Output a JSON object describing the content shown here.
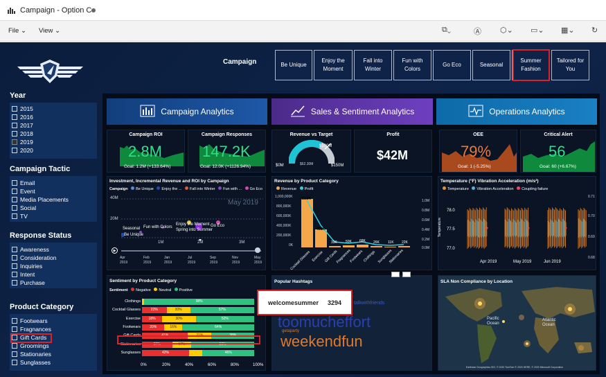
{
  "window": {
    "title": "Campaign - Option C"
  },
  "menu": {
    "file": "File",
    "view": "View"
  },
  "slicers": {
    "year": {
      "title": "Year",
      "items": [
        "2015",
        "2016",
        "2017",
        "2018",
        "2019",
        "2020"
      ],
      "checked": "2019"
    },
    "tactic": {
      "title": "Campaign Tactic",
      "items": [
        "Email",
        "Event",
        "Media Placements",
        "Social",
        "TV"
      ]
    },
    "response": {
      "title": "Response Status",
      "items": [
        "Awareness",
        "Consideration",
        "Inquiries",
        "Intent",
        "Purchase"
      ]
    },
    "category": {
      "title": "Product Category",
      "items": [
        "Footwears",
        "Fragnances",
        "Gift Cards",
        "Groomings",
        "Stationaries",
        "Sunglasses"
      ],
      "selected": "Gift Cards"
    }
  },
  "campaign": {
    "label": "Campaign",
    "buttons": [
      "Be Unique",
      "Enjoy the Moment",
      "Fall into Winter",
      "Fun with Colors",
      "Go Eco",
      "Seasonal",
      "Summer Fashion",
      "Tailored for You"
    ],
    "selected": "Summer Fashion"
  },
  "headers": {
    "campaign": "Campaign Analytics",
    "sales": "Sales & Sentiment Analytics",
    "ops": "Operations Analytics"
  },
  "kpi": {
    "roi": {
      "title": "Campaign ROI",
      "value": "2.8M",
      "goal": "Goal: 1.2M (+133.64%)"
    },
    "responses": {
      "title": "Campaign Responses",
      "value": "147.2K",
      "goal": "Goal: 12.0K (+1126.94%)"
    },
    "revenue": {
      "title": "Revenue vs Target",
      "min": "$0M",
      "max": "$150M",
      "target": "$100M",
      "value": "$62.30M"
    },
    "profit": {
      "title": "Profit",
      "value": "$42M"
    },
    "oee": {
      "title": "OEE",
      "value": "79%",
      "goal": "Goal: 1 (-5.25%)"
    },
    "alert": {
      "title": "Critical Alert",
      "value": "56",
      "goal": "Goal: 60 (+6.67%)"
    }
  },
  "investment": {
    "title": "Investment, Incremental Revenue and ROI by Campaign",
    "legend_label": "Campaign",
    "legend": [
      "Be Unique",
      "Enjoy the ...",
      "Fall into Winter",
      "Fun with ...",
      "Go Eco"
    ],
    "watermark": "May 2019",
    "yticks": [
      "40M",
      "20M"
    ],
    "xticks": [
      "1M",
      "2M",
      "3M"
    ],
    "points": [
      "Seasonal",
      "Be Unique",
      "Fun with Colors",
      "Enjoy the Moment",
      "Spring into Summer",
      "Go Eco"
    ],
    "timeline": [
      "Apr 2019",
      "Feb 2019",
      "Jan 2019",
      "Jul 2019",
      "Sep 2019",
      "Nov 2019",
      "May 2019"
    ]
  },
  "revenue_product": {
    "title": "Revenue by Product Category",
    "legend": [
      "Revenue",
      "Profit"
    ],
    "yticks": [
      "1,000,000K",
      "800,000K",
      "600,000K",
      "400,000K",
      "200,000K",
      "0K"
    ],
    "y2ticks": [
      "1.0M",
      "0.8M",
      "0.6M",
      "0.4M",
      "0.2M",
      "0.0M"
    ],
    "categories": [
      "Cocktail Glasses",
      "Exercise",
      "Gift Cards",
      "Fragnances",
      "Footwears",
      "Clothings",
      "Sunglasses",
      "Stationaries"
    ],
    "labels": [
      "1118K",
      "401K",
      "33K",
      "50K",
      "68K",
      "26K",
      "11K",
      "22K"
    ]
  },
  "temperature": {
    "title": "Temperature (°F) Vibration Acceleration (m/s²)",
    "legend": [
      "Temperature",
      "Vibration Acceleration",
      "Coupling failure"
    ],
    "yticks": [
      "78.0",
      "77.5",
      "77.0"
    ],
    "y2ticks": [
      "0.71",
      "0.70",
      "0.69",
      "0.68"
    ],
    "xticks": [
      "Apr 2019",
      "May 2019",
      "Jun 2019"
    ],
    "ylabel": "Temperature"
  },
  "sentiment": {
    "title": "Sentiment by Product Category",
    "legend_label": "Sentiment",
    "legend": [
      "Negative",
      "Neutral",
      "Positive"
    ],
    "rows": [
      {
        "name": "Clothings",
        "v": [
          "",
          "",
          "98%"
        ]
      },
      {
        "name": "Cocktail Glasses",
        "v": [
          "22%",
          "20%",
          "57%"
        ]
      },
      {
        "name": "Exercise",
        "v": [
          "18%",
          "30%",
          "52%"
        ]
      },
      {
        "name": "Footwears",
        "v": [
          "20%",
          "16%",
          "64%"
        ]
      },
      {
        "name": "Gift Cards",
        "v": [
          "41%",
          "21%",
          "38%"
        ]
      },
      {
        "name": "Stationaries",
        "v": [
          "27%",
          "17%",
          "56%"
        ]
      },
      {
        "name": "Sunglasses",
        "v": [
          "42%",
          "",
          "46%"
        ]
      }
    ],
    "xticks": [
      "0%",
      "20%",
      "40%",
      "60%",
      "80%",
      "100%"
    ]
  },
  "hashtags": {
    "title": "Popular Hashtags",
    "tooltip_tag": "welcomesummer",
    "tooltip_count": "3294",
    "words": [
      "talkwithfriends",
      "toomucheffort",
      "getaparty",
      "weekendfun"
    ]
  },
  "sla": {
    "title": "SLA Non Compliance by Location",
    "labels": [
      "Pacific Ocean",
      "Atlantic Ocean"
    ],
    "credit": "Earthstar Geographics SIO, © 2020 TomTom © 2020 HERE, © 2020 Microsoft Corporation"
  },
  "colors": {
    "green": "#00b050",
    "orange": "#e46c0a",
    "negative": "#e8312f",
    "neutral": "#ffcc00",
    "positive": "#2ec27e",
    "accent": "#f5a84a",
    "red_outline": "#d8232a"
  }
}
